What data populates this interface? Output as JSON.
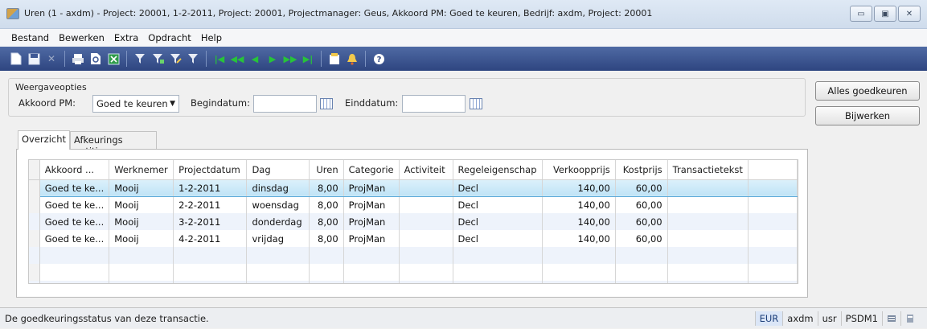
{
  "window": {
    "title": "Uren (1 - axdm) - Project: 20001, 1-2-2011, Project: 20001, Projectmanager: Geus, Akkoord PM: Goed te keuren, Bedrijf: axdm, Project: 20001",
    "minimize": "▭",
    "maximize": "▣",
    "close": "✕"
  },
  "menu": [
    "Bestand",
    "Bewerken",
    "Extra",
    "Opdracht",
    "Help"
  ],
  "toolbar": {
    "icons": [
      "new-icon",
      "save-icon",
      "delete-icon",
      "print-icon",
      "print-preview-icon",
      "export-icon",
      "filter-icon",
      "filter-by-selection-icon",
      "advanced-filter-icon",
      "filter-clear-icon",
      "first-record-icon",
      "previous-page-icon",
      "previous-record-icon",
      "next-record-icon",
      "next-page-icon",
      "last-record-icon",
      "document-handling-icon",
      "alert-icon",
      "help-icon"
    ]
  },
  "options": {
    "legend": "Weergaveopties",
    "akkoord_label": "Akkoord PM:",
    "akkoord_value": "Goed te keuren",
    "begindatum_label": "Begindatum:",
    "begindatum_value": "",
    "einddatum_label": "Einddatum:",
    "einddatum_value": ""
  },
  "buttons": {
    "approve_all": "Alles goedkeuren",
    "update": "Bijwerken"
  },
  "tabs": [
    "Overzicht",
    "Afkeurings notitie"
  ],
  "grid": {
    "columns": [
      "Akkoord ...",
      "Werknemer",
      "Projectdatum",
      "Dag",
      "Uren",
      "Categorie",
      "Activiteit",
      "Regeleigenschap",
      "Verkoopprijs",
      "Kostprijs",
      "Transactietekst",
      ""
    ],
    "rows": [
      [
        "Goed te ke...",
        "Mooij",
        "1-2-2011",
        "dinsdag",
        "8,00",
        "ProjMan",
        "",
        "Decl",
        "140,00",
        "60,00",
        "",
        ""
      ],
      [
        "Goed te ke...",
        "Mooij",
        "2-2-2011",
        "woensdag",
        "8,00",
        "ProjMan",
        "",
        "Decl",
        "140,00",
        "60,00",
        "",
        ""
      ],
      [
        "Goed te ke...",
        "Mooij",
        "3-2-2011",
        "donderdag",
        "8,00",
        "ProjMan",
        "",
        "Decl",
        "140,00",
        "60,00",
        "",
        ""
      ],
      [
        "Goed te ke...",
        "Mooij",
        "4-2-2011",
        "vrijdag",
        "8,00",
        "ProjMan",
        "",
        "Decl",
        "140,00",
        "60,00",
        "",
        ""
      ]
    ],
    "selected_row": 0
  },
  "status": {
    "text": "De goedkeuringsstatus van deze transactie.",
    "currency": "EUR",
    "company": "axdm",
    "layer": "usr",
    "server": "PSDM1"
  },
  "colors": {
    "toolbar": "#3a5291",
    "selection": "#c8e7f7",
    "alt_row": "#eef3fb"
  }
}
